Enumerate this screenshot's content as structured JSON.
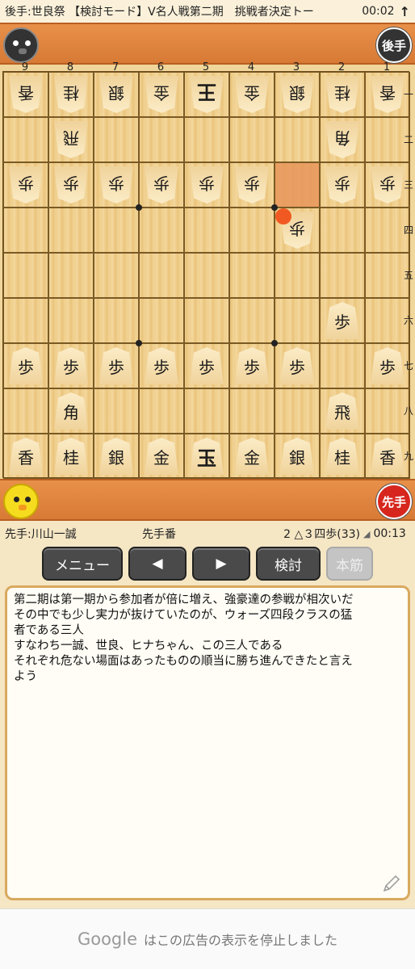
{
  "status_bar": {
    "title": "後手:世良祭 【検討モード】V名人戦第二期　挑戦者決定トー",
    "clock": "00:02",
    "arrow": "↑"
  },
  "top_player": {
    "badge": "後手"
  },
  "bottom_player": {
    "badge": "先手"
  },
  "board": {
    "file_labels": [
      "9",
      "8",
      "7",
      "6",
      "5",
      "4",
      "3",
      "2",
      "1"
    ],
    "rank_labels": [
      "一",
      "二",
      "三",
      "四",
      "五",
      "六",
      "七",
      "八",
      "九"
    ],
    "pieces": [
      {
        "file": 9,
        "rank": 1,
        "char": "香",
        "side": "gote"
      },
      {
        "file": 8,
        "rank": 1,
        "char": "桂",
        "side": "gote"
      },
      {
        "file": 7,
        "rank": 1,
        "char": "銀",
        "side": "gote"
      },
      {
        "file": 6,
        "rank": 1,
        "char": "金",
        "side": "gote"
      },
      {
        "file": 5,
        "rank": 1,
        "char": "王",
        "side": "gote",
        "king": true
      },
      {
        "file": 4,
        "rank": 1,
        "char": "金",
        "side": "gote"
      },
      {
        "file": 3,
        "rank": 1,
        "char": "銀",
        "side": "gote"
      },
      {
        "file": 2,
        "rank": 1,
        "char": "桂",
        "side": "gote"
      },
      {
        "file": 1,
        "rank": 1,
        "char": "香",
        "side": "gote"
      },
      {
        "file": 8,
        "rank": 2,
        "char": "飛",
        "side": "gote"
      },
      {
        "file": 2,
        "rank": 2,
        "char": "角",
        "side": "gote"
      },
      {
        "file": 9,
        "rank": 3,
        "char": "歩",
        "side": "gote"
      },
      {
        "file": 8,
        "rank": 3,
        "char": "歩",
        "side": "gote"
      },
      {
        "file": 7,
        "rank": 3,
        "char": "歩",
        "side": "gote"
      },
      {
        "file": 6,
        "rank": 3,
        "char": "歩",
        "side": "gote"
      },
      {
        "file": 5,
        "rank": 3,
        "char": "歩",
        "side": "gote"
      },
      {
        "file": 4,
        "rank": 3,
        "char": "歩",
        "side": "gote"
      },
      {
        "file": 2,
        "rank": 3,
        "char": "歩",
        "side": "gote"
      },
      {
        "file": 1,
        "rank": 3,
        "char": "歩",
        "side": "gote"
      },
      {
        "file": 3,
        "rank": 4,
        "char": "歩",
        "side": "gote"
      },
      {
        "file": 2,
        "rank": 6,
        "char": "歩",
        "side": "sente"
      },
      {
        "file": 9,
        "rank": 7,
        "char": "歩",
        "side": "sente"
      },
      {
        "file": 8,
        "rank": 7,
        "char": "歩",
        "side": "sente"
      },
      {
        "file": 7,
        "rank": 7,
        "char": "歩",
        "side": "sente"
      },
      {
        "file": 6,
        "rank": 7,
        "char": "歩",
        "side": "sente"
      },
      {
        "file": 5,
        "rank": 7,
        "char": "歩",
        "side": "sente"
      },
      {
        "file": 4,
        "rank": 7,
        "char": "歩",
        "side": "sente"
      },
      {
        "file": 3,
        "rank": 7,
        "char": "歩",
        "side": "sente"
      },
      {
        "file": 1,
        "rank": 7,
        "char": "歩",
        "side": "sente"
      },
      {
        "file": 8,
        "rank": 8,
        "char": "角",
        "side": "sente"
      },
      {
        "file": 2,
        "rank": 8,
        "char": "飛",
        "side": "sente"
      },
      {
        "file": 9,
        "rank": 9,
        "char": "香",
        "side": "sente"
      },
      {
        "file": 8,
        "rank": 9,
        "char": "桂",
        "side": "sente"
      },
      {
        "file": 7,
        "rank": 9,
        "char": "銀",
        "side": "sente"
      },
      {
        "file": 6,
        "rank": 9,
        "char": "金",
        "side": "sente"
      },
      {
        "file": 5,
        "rank": 9,
        "char": "玉",
        "side": "sente",
        "king": true
      },
      {
        "file": 4,
        "rank": 9,
        "char": "金",
        "side": "sente"
      },
      {
        "file": 3,
        "rank": 9,
        "char": "銀",
        "side": "sente"
      },
      {
        "file": 2,
        "rank": 9,
        "char": "桂",
        "side": "sente"
      },
      {
        "file": 1,
        "rank": 9,
        "char": "香",
        "side": "sente"
      }
    ],
    "highlight_square": {
      "file": 3,
      "rank": 3
    },
    "last_move_square": {
      "file": 3,
      "rank": 4
    }
  },
  "info": {
    "sente_name": "先手:川山一誠",
    "turn": "先手番",
    "last_move": "2 △３四歩(33)",
    "time": "00:13"
  },
  "toolbar": {
    "menu": "メニュー",
    "prev": "◀",
    "next": "▶",
    "kento": "検討",
    "honsuji": "本筋"
  },
  "comment": {
    "lines": [
      "第二期は第一期から参加者が倍に増え、強豪達の参戦が相次いだ",
      "その中でも少し実力が抜けていたのが、ウォーズ四段クラスの猛",
      "者である三人",
      "すなわち一誠、世良、ヒナちゃん、この三人である",
      "それぞれ危ない場面はあったものの順当に勝ち進んできたと言え",
      "よう"
    ]
  },
  "ad": {
    "logo": "Google",
    "text": "はこの広告の表示を停止しました"
  },
  "colors": {
    "accent": "#d7261e",
    "bar": "#e8904a",
    "highlight": "#e8955b"
  }
}
